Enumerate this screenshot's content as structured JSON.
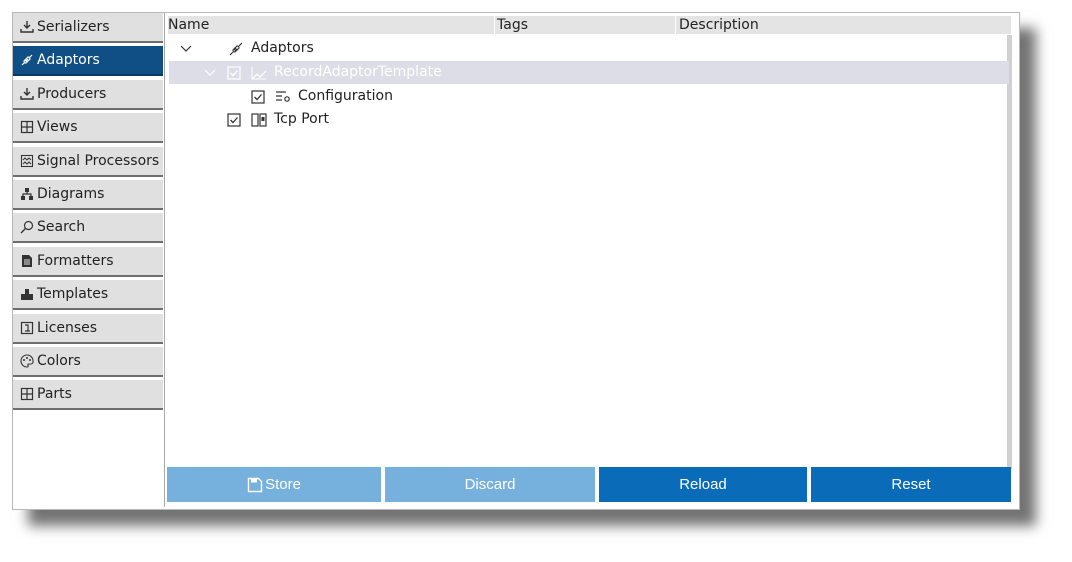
{
  "sidebar": {
    "items": [
      {
        "label": "Serializers",
        "icon": "download-tray-icon"
      },
      {
        "label": "Adaptors",
        "icon": "plug-icon"
      },
      {
        "label": "Producers",
        "icon": "download-tray-icon"
      },
      {
        "label": "Views",
        "icon": "grid-icon"
      },
      {
        "label": "Signal Processors",
        "icon": "signal-chart-icon"
      },
      {
        "label": "Diagrams",
        "icon": "hierarchy-icon"
      },
      {
        "label": "Search",
        "icon": "search-icon"
      },
      {
        "label": "Formatters",
        "icon": "document-icon"
      },
      {
        "label": "Templates",
        "icon": "stamp-icon"
      },
      {
        "label": "Licenses",
        "icon": "license-icon"
      },
      {
        "label": "Colors",
        "icon": "palette-icon"
      },
      {
        "label": "Parts",
        "icon": "grid-icon"
      }
    ],
    "active_index": 1
  },
  "table": {
    "columns": {
      "name": "Name",
      "tags": "Tags",
      "description": "Description"
    },
    "rows": [
      {
        "label": "Adaptors",
        "icon": "plug-icon",
        "expanded": true
      },
      {
        "label": "RecordAdaptorTemplate",
        "icon": "line-chart-icon",
        "checked": true,
        "expanded": true,
        "selected": true
      },
      {
        "label": "Configuration",
        "icon": "settings-list-icon",
        "checked": true
      },
      {
        "label": "Tcp Port",
        "icon": "port-icon",
        "checked": true
      }
    ]
  },
  "buttons": {
    "store": "Store",
    "discard": "Discard",
    "reload": "Reload",
    "reset": "Reset"
  },
  "colors": {
    "active_nav": "#0f4f86",
    "button_enabled": "#0a6cb8",
    "button_disabled": "#76b1dd",
    "selected_row": "#dcdde6"
  }
}
